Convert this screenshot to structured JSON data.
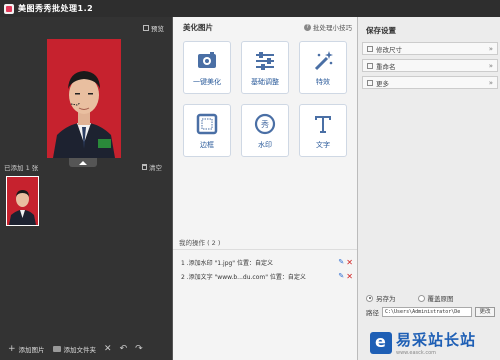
{
  "window": {
    "title": "美图秀秀批处理1.2"
  },
  "left": {
    "preview_label": "预览",
    "added_count": "已添加 1 张",
    "clear_label": "清空",
    "bottom": {
      "add_image": "添加图片",
      "add_folder": "添加文件夹"
    }
  },
  "middle": {
    "title": "美化图片",
    "tips_label": "批处理小技巧",
    "tools": [
      {
        "label": "一键美化",
        "icon": "magic-photo-icon"
      },
      {
        "label": "基础调整",
        "icon": "sliders-icon"
      },
      {
        "label": "特效",
        "icon": "magic-wand-icon"
      },
      {
        "label": "边框",
        "icon": "frame-icon"
      },
      {
        "label": "水印",
        "icon": "watermark-icon"
      },
      {
        "label": "文字",
        "icon": "text-icon"
      }
    ],
    "ops_title": "我的操作 ( 2 )",
    "ops": [
      {
        "text": "1 .添加水印 \"1.jpg\" 位置：自定义"
      },
      {
        "text": "2 .添加文字 \"www.b...du.com\" 位置：自定义"
      }
    ]
  },
  "right": {
    "title": "保存设置",
    "sections": [
      {
        "label": "修改尺寸"
      },
      {
        "label": "重命名"
      },
      {
        "label": "更多"
      }
    ],
    "save_as": "另存为",
    "overwrite": "覆盖原图",
    "path_label": "路径",
    "path_value": "C:\\Users\\Administrator\\De",
    "change_label": "更改"
  },
  "watermark": {
    "brand": "易采站长站",
    "url": "www.easck.com"
  },
  "colors": {
    "accent": "#2a5a9a",
    "photo_bg": "#c6222e",
    "delete": "#d02020"
  }
}
